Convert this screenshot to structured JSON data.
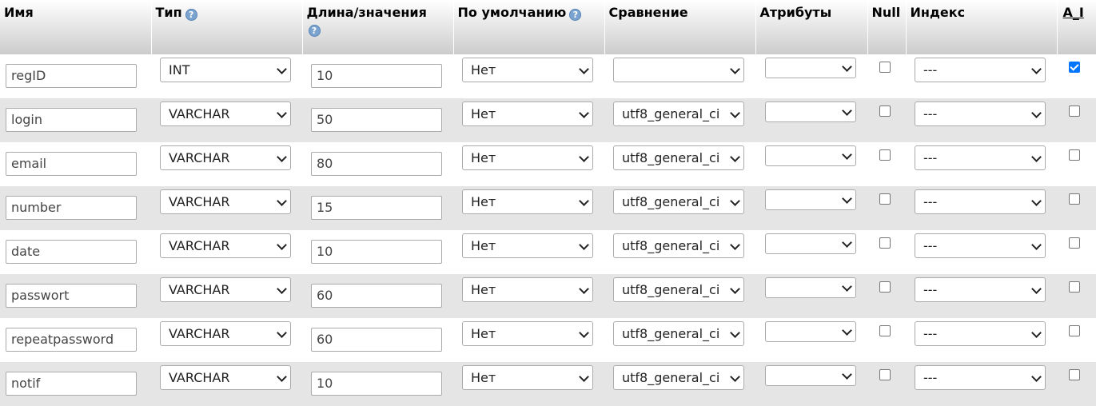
{
  "headers": {
    "name": "Имя",
    "type": "Тип",
    "length": "Длина/значения",
    "default": "По умолчанию",
    "collation": "Сравнение",
    "attributes": "Атрибуты",
    "null": "Null",
    "index": "Индекс",
    "ai": "A_I",
    "help_icon": "?"
  },
  "rows": [
    {
      "name": "regID",
      "type": "INT",
      "length": "10",
      "default": "Нет",
      "collation": "",
      "attributes": "",
      "null": false,
      "index": "---",
      "ai": true
    },
    {
      "name": "login",
      "type": "VARCHAR",
      "length": "50",
      "default": "Нет",
      "collation": "utf8_general_ci",
      "attributes": "",
      "null": false,
      "index": "---",
      "ai": false
    },
    {
      "name": "email",
      "type": "VARCHAR",
      "length": "80",
      "default": "Нет",
      "collation": "utf8_general_ci",
      "attributes": "",
      "null": false,
      "index": "---",
      "ai": false
    },
    {
      "name": "number",
      "type": "VARCHAR",
      "length": "15",
      "default": "Нет",
      "collation": "utf8_general_ci",
      "attributes": "",
      "null": false,
      "index": "---",
      "ai": false
    },
    {
      "name": "date",
      "type": "VARCHAR",
      "length": "10",
      "default": "Нет",
      "collation": "utf8_general_ci",
      "attributes": "",
      "null": false,
      "index": "---",
      "ai": false
    },
    {
      "name": "passwort",
      "type": "VARCHAR",
      "length": "60",
      "default": "Нет",
      "collation": "utf8_general_ci",
      "attributes": "",
      "null": false,
      "index": "---",
      "ai": false
    },
    {
      "name": "repeatpassword",
      "type": "VARCHAR",
      "length": "60",
      "default": "Нет",
      "collation": "utf8_general_ci",
      "attributes": "",
      "null": false,
      "index": "---",
      "ai": false
    },
    {
      "name": "notif",
      "type": "VARCHAR",
      "length": "10",
      "default": "Нет",
      "collation": "utf8_general_ci",
      "attributes": "",
      "null": false,
      "index": "---",
      "ai": false
    }
  ],
  "colors": {
    "header_top": "#ffffff",
    "header_bottom": "#cccccc",
    "row_alt": "#e5e5e5",
    "checkbox_checked": "#0075ff",
    "help_icon": "#7aa3cf"
  }
}
